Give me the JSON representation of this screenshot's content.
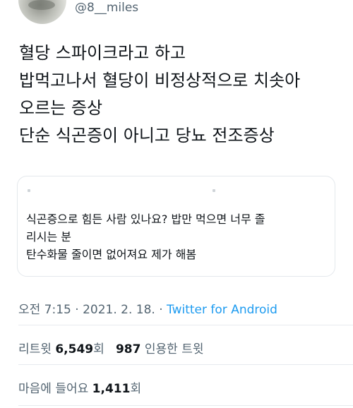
{
  "author": {
    "handle": "@8__miles"
  },
  "tweet": {
    "lines": [
      "혈당 스파이크라고 하고",
      "밥먹고나서 혈당이 비정상적으로 치솟아",
      "오르는 증상",
      "단순 식곤증이 아니고 당뇨 전조증상"
    ]
  },
  "quote": {
    "lines": [
      "식곤증으로 힘든 사람 있나요? 밥만 먹으면 너무 졸",
      "리시는 분",
      "탄수화물 줄이면 없어져요 제가 해봄"
    ]
  },
  "meta": {
    "time": "오전 7:15",
    "sep1": " · ",
    "date": "2021. 2. 18.",
    "sep2": " · ",
    "source": "Twitter for Android"
  },
  "stats": {
    "retweets_label": "리트윗",
    "retweets_count": "6,549",
    "retweets_unit": "회",
    "quotes_count": "987",
    "quotes_label": "인용한 트윗"
  },
  "likes": {
    "label": "마음에 들어요",
    "count": "1,411",
    "unit": "회"
  },
  "colors": {
    "text": "#0f1419",
    "secondary": "#536471",
    "link": "#1d9bf0",
    "border": "#e4e8ec"
  }
}
